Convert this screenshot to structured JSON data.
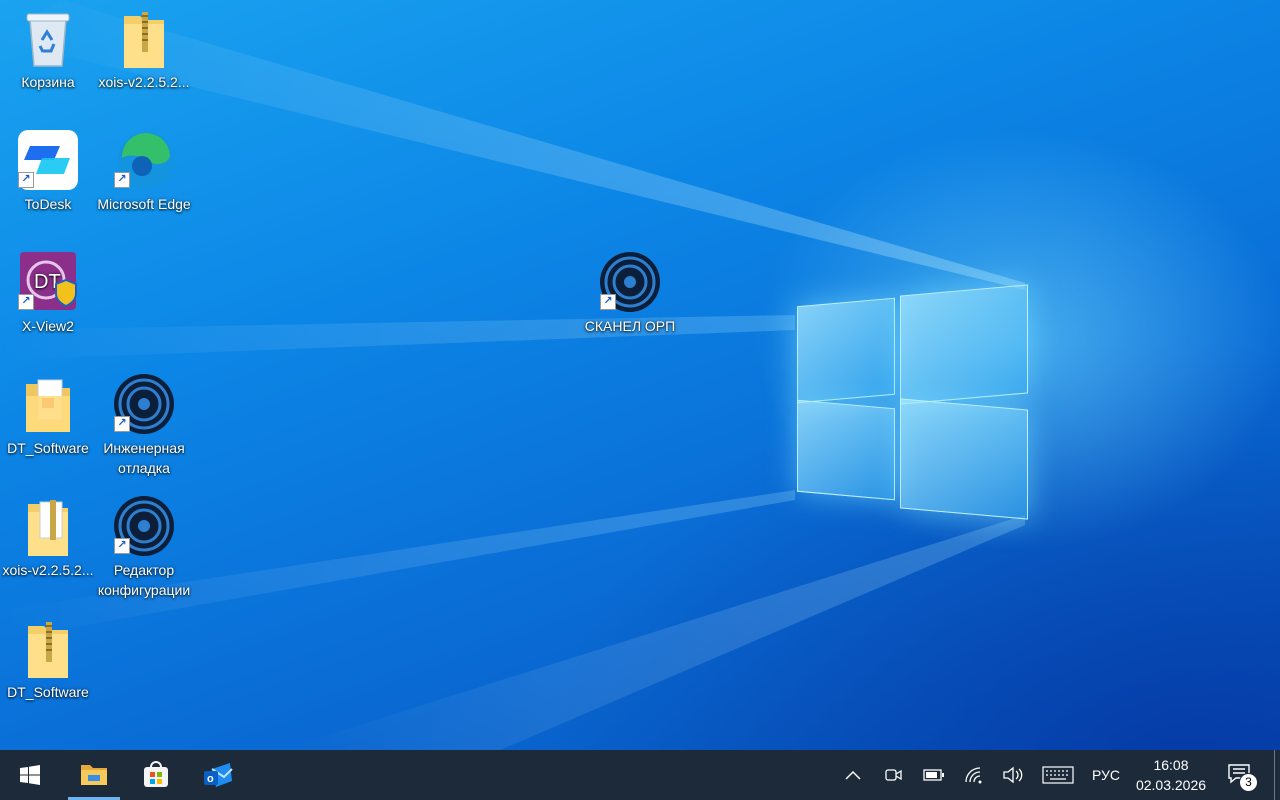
{
  "desktop": {
    "icons": [
      {
        "label": "Корзина",
        "icon": "recycle-bin-icon"
      },
      {
        "label": "xois-v2.2.5.2...",
        "icon": "zip-folder-icon"
      },
      {
        "label": "ToDesk",
        "icon": "todesk-icon"
      },
      {
        "label": "Microsoft Edge",
        "icon": "edge-icon"
      },
      {
        "label": "X-View2",
        "icon": "xview-icon"
      },
      {
        "label": "DT_Software",
        "icon": "folder-icon"
      },
      {
        "label": "Инженерная отладка",
        "icon": "scanner-app-icon"
      },
      {
        "label": "xois-v2.2.5.2...",
        "icon": "zip-folder-icon"
      },
      {
        "label": "Редактор конфигурации",
        "icon": "scanner-app-icon"
      },
      {
        "label": "DT_Software",
        "icon": "zip-folder-icon"
      },
      {
        "label": "СКАНЕЛ ОРП",
        "icon": "scanner-app-icon"
      }
    ]
  },
  "taskbar": {
    "pinned": [
      "start-icon",
      "file-explorer-icon",
      "store-icon",
      "outlook-icon"
    ],
    "tray": {
      "language": "РУС",
      "time": "16:08",
      "date": "02.03.2026",
      "notification_count": "3"
    }
  },
  "colors": {
    "taskbar": "#1c2a3a",
    "accent": "#0a6dd6"
  }
}
